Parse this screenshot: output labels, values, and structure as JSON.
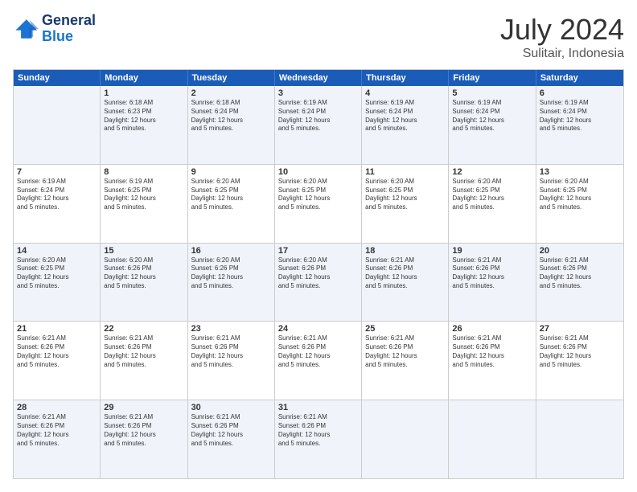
{
  "header": {
    "logo_line1": "General",
    "logo_line2": "Blue",
    "month_year": "July 2024",
    "location": "Sulitair, Indonesia"
  },
  "weekdays": [
    "Sunday",
    "Monday",
    "Tuesday",
    "Wednesday",
    "Thursday",
    "Friday",
    "Saturday"
  ],
  "rows": [
    [
      {
        "day": "",
        "info": ""
      },
      {
        "day": "1",
        "info": "Sunrise: 6:18 AM\nSunset: 6:23 PM\nDaylight: 12 hours\nand 5 minutes."
      },
      {
        "day": "2",
        "info": "Sunrise: 6:18 AM\nSunset: 6:24 PM\nDaylight: 12 hours\nand 5 minutes."
      },
      {
        "day": "3",
        "info": "Sunrise: 6:19 AM\nSunset: 6:24 PM\nDaylight: 12 hours\nand 5 minutes."
      },
      {
        "day": "4",
        "info": "Sunrise: 6:19 AM\nSunset: 6:24 PM\nDaylight: 12 hours\nand 5 minutes."
      },
      {
        "day": "5",
        "info": "Sunrise: 6:19 AM\nSunset: 6:24 PM\nDaylight: 12 hours\nand 5 minutes."
      },
      {
        "day": "6",
        "info": "Sunrise: 6:19 AM\nSunset: 6:24 PM\nDaylight: 12 hours\nand 5 minutes."
      }
    ],
    [
      {
        "day": "7",
        "info": "Sunrise: 6:19 AM\nSunset: 6:24 PM\nDaylight: 12 hours\nand 5 minutes."
      },
      {
        "day": "8",
        "info": "Sunrise: 6:19 AM\nSunset: 6:25 PM\nDaylight: 12 hours\nand 5 minutes."
      },
      {
        "day": "9",
        "info": "Sunrise: 6:20 AM\nSunset: 6:25 PM\nDaylight: 12 hours\nand 5 minutes."
      },
      {
        "day": "10",
        "info": "Sunrise: 6:20 AM\nSunset: 6:25 PM\nDaylight: 12 hours\nand 5 minutes."
      },
      {
        "day": "11",
        "info": "Sunrise: 6:20 AM\nSunset: 6:25 PM\nDaylight: 12 hours\nand 5 minutes."
      },
      {
        "day": "12",
        "info": "Sunrise: 6:20 AM\nSunset: 6:25 PM\nDaylight: 12 hours\nand 5 minutes."
      },
      {
        "day": "13",
        "info": "Sunrise: 6:20 AM\nSunset: 6:25 PM\nDaylight: 12 hours\nand 5 minutes."
      }
    ],
    [
      {
        "day": "14",
        "info": "Sunrise: 6:20 AM\nSunset: 6:25 PM\nDaylight: 12 hours\nand 5 minutes."
      },
      {
        "day": "15",
        "info": "Sunrise: 6:20 AM\nSunset: 6:26 PM\nDaylight: 12 hours\nand 5 minutes."
      },
      {
        "day": "16",
        "info": "Sunrise: 6:20 AM\nSunset: 6:26 PM\nDaylight: 12 hours\nand 5 minutes."
      },
      {
        "day": "17",
        "info": "Sunrise: 6:20 AM\nSunset: 6:26 PM\nDaylight: 12 hours\nand 5 minutes."
      },
      {
        "day": "18",
        "info": "Sunrise: 6:21 AM\nSunset: 6:26 PM\nDaylight: 12 hours\nand 5 minutes."
      },
      {
        "day": "19",
        "info": "Sunrise: 6:21 AM\nSunset: 6:26 PM\nDaylight: 12 hours\nand 5 minutes."
      },
      {
        "day": "20",
        "info": "Sunrise: 6:21 AM\nSunset: 6:26 PM\nDaylight: 12 hours\nand 5 minutes."
      }
    ],
    [
      {
        "day": "21",
        "info": "Sunrise: 6:21 AM\nSunset: 6:26 PM\nDaylight: 12 hours\nand 5 minutes."
      },
      {
        "day": "22",
        "info": "Sunrise: 6:21 AM\nSunset: 6:26 PM\nDaylight: 12 hours\nand 5 minutes."
      },
      {
        "day": "23",
        "info": "Sunrise: 6:21 AM\nSunset: 6:26 PM\nDaylight: 12 hours\nand 5 minutes."
      },
      {
        "day": "24",
        "info": "Sunrise: 6:21 AM\nSunset: 6:26 PM\nDaylight: 12 hours\nand 5 minutes."
      },
      {
        "day": "25",
        "info": "Sunrise: 6:21 AM\nSunset: 6:26 PM\nDaylight: 12 hours\nand 5 minutes."
      },
      {
        "day": "26",
        "info": "Sunrise: 6:21 AM\nSunset: 6:26 PM\nDaylight: 12 hours\nand 5 minutes."
      },
      {
        "day": "27",
        "info": "Sunrise: 6:21 AM\nSunset: 6:26 PM\nDaylight: 12 hours\nand 5 minutes."
      }
    ],
    [
      {
        "day": "28",
        "info": "Sunrise: 6:21 AM\nSunset: 6:26 PM\nDaylight: 12 hours\nand 5 minutes."
      },
      {
        "day": "29",
        "info": "Sunrise: 6:21 AM\nSunset: 6:26 PM\nDaylight: 12 hours\nand 5 minutes."
      },
      {
        "day": "30",
        "info": "Sunrise: 6:21 AM\nSunset: 6:26 PM\nDaylight: 12 hours\nand 5 minutes."
      },
      {
        "day": "31",
        "info": "Sunrise: 6:21 AM\nSunset: 6:26 PM\nDaylight: 12 hours\nand 5 minutes."
      },
      {
        "day": "",
        "info": ""
      },
      {
        "day": "",
        "info": ""
      },
      {
        "day": "",
        "info": ""
      }
    ]
  ],
  "colors": {
    "header_bg": "#1a5cb8",
    "alt_row": "#eef2fa"
  }
}
